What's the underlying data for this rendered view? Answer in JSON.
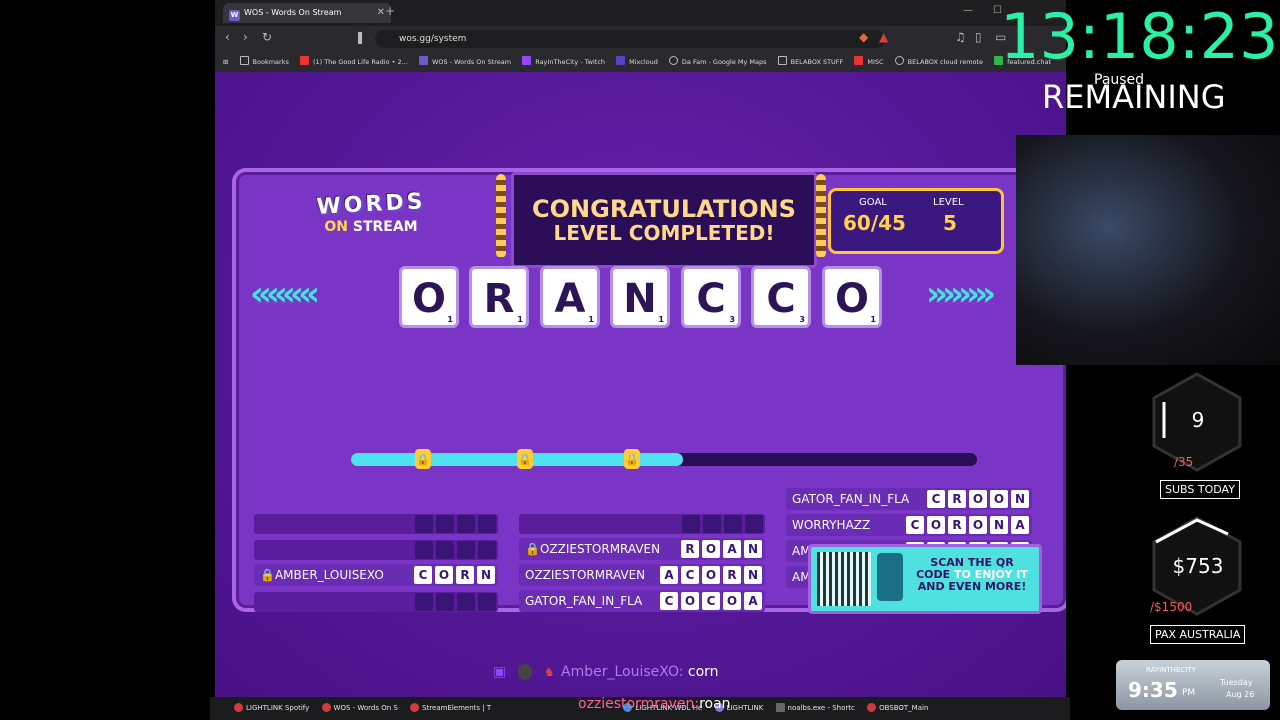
{
  "browser": {
    "tab_title": "WOS - Words On Stream",
    "url": "wos.gg/system",
    "bookmarks": [
      "Bookmarks",
      "(1) The Good Life Radio • 2...",
      "WOS - Words On Stream",
      "RayInTheCity - Twitch",
      "Mixcloud",
      "Da Fam - Google My Maps",
      "BELABOX STUFF",
      "MISC",
      "BELABOX cloud remote",
      "featured.chat"
    ]
  },
  "game": {
    "logo_top": "WORDS",
    "logo_bottom_on": "ON",
    "logo_bottom": "STREAM",
    "congrats_line1": "CONGRATULATIONS",
    "congrats_line2": "LEVEL COMPLETED!",
    "goal_label": "GOAL",
    "goal_value": "60/45",
    "level_label": "LEVEL",
    "level_value": "5",
    "letters": [
      {
        "ch": "O",
        "n": "1"
      },
      {
        "ch": "R",
        "n": "1"
      },
      {
        "ch": "A",
        "n": "1"
      },
      {
        "ch": "N",
        "n": "1"
      },
      {
        "ch": "C",
        "n": "3"
      },
      {
        "ch": "C",
        "n": "3"
      },
      {
        "ch": "O",
        "n": "1"
      }
    ],
    "progress_fraction": 0.53,
    "answers": [
      {
        "name": "AMBER_LOUISEXO",
        "word": "CORN",
        "locked": true
      },
      {
        "name": "OZZIESTORMRAVEN",
        "word": "ROAN",
        "locked": true
      },
      {
        "name": "OZZIESTORMRAVEN",
        "word": "ACORN",
        "locked": false
      },
      {
        "name": "GATOR_FAN_IN_FLA",
        "word": "COCOA",
        "locked": false
      },
      {
        "name": "GATOR_FAN_IN_FLA",
        "word": "CROON",
        "locked": false
      },
      {
        "name": "WORRYHAZZ",
        "word": "CORONA",
        "locked": false
      },
      {
        "name": "AMBER_LOUIS···",
        "word": "RACOON",
        "locked": false
      },
      {
        "name": "AMBER_LO···",
        "word": "RACCOON",
        "locked": false
      }
    ],
    "qr_text_dark1": "SCAN THE QR",
    "qr_text_dark2": "CODE",
    "qr_text_light": "TO ENJOY IT",
    "qr_text_dark3": "AND EVEN MORE!"
  },
  "chat": [
    {
      "user": "Amber_LouiseXO:",
      "msg": "corn"
    },
    {
      "user": "ozziestormraven:",
      "msg": "roan"
    }
  ],
  "overlay": {
    "timer": "13:18:23",
    "paused": "Paused",
    "remaining": "REMAINING",
    "subs_count": "9",
    "subs_goal": "/35",
    "subs_label": "SUBS TODAY",
    "money": "$753",
    "money_goal": "/$1500",
    "money_label": "PAX AUSTRALIA",
    "clock_brand": "RAYINTHECITY",
    "clock_time": "9:35",
    "clock_ampm": "PM",
    "clock_day": "Tuesday",
    "clock_date": "Aug 26"
  },
  "taskbar": [
    "LIGHTLINK Spotify",
    "WOS - Words On S",
    "StreamElements | T",
    "LIGHTLINK WDL He",
    "LIGHTLINK",
    "noalbs.exe - Shortc",
    "OBSBOT_Main"
  ],
  "colors": {
    "timer": "#2cf0a5",
    "accent_cyan": "#4ee3ee",
    "gold": "#ffd24a",
    "purple": "#5b1a9c"
  }
}
